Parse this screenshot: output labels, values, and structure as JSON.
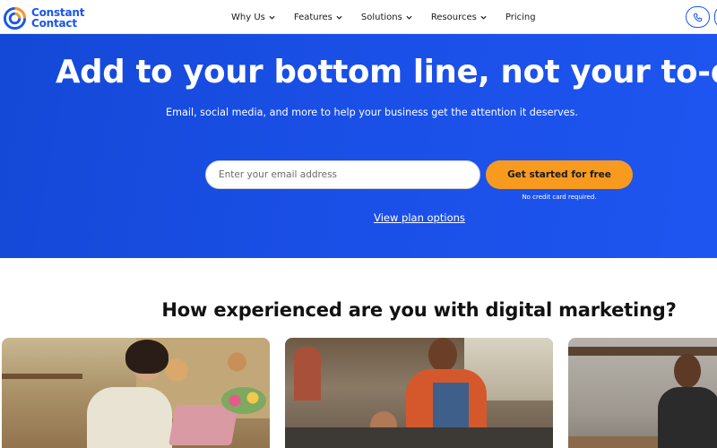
{
  "nav": {
    "brand_line1": "Constant",
    "brand_line2": "Contact",
    "items": [
      {
        "label": "Why Us",
        "dropdown": true
      },
      {
        "label": "Features",
        "dropdown": true
      },
      {
        "label": "Solutions",
        "dropdown": true
      },
      {
        "label": "Resources",
        "dropdown": true
      },
      {
        "label": "Pricing",
        "dropdown": false
      }
    ],
    "phone_icon": "phone-icon"
  },
  "hero": {
    "title": "Add to your bottom line, not your to-do",
    "subtitle": "Email, social media, and more to help your business get the attention it deserves.",
    "email_placeholder": "Enter your email address",
    "email_value": "",
    "cta_label": "Get started for free",
    "note": "No credit card required.",
    "plan_link": "View plan options"
  },
  "section": {
    "title": "How experienced are you with digital marketing?"
  },
  "colors": {
    "brand_blue": "#1856ed",
    "hero_blue": "#1a4fe6",
    "cta_orange": "#f79a1e"
  }
}
